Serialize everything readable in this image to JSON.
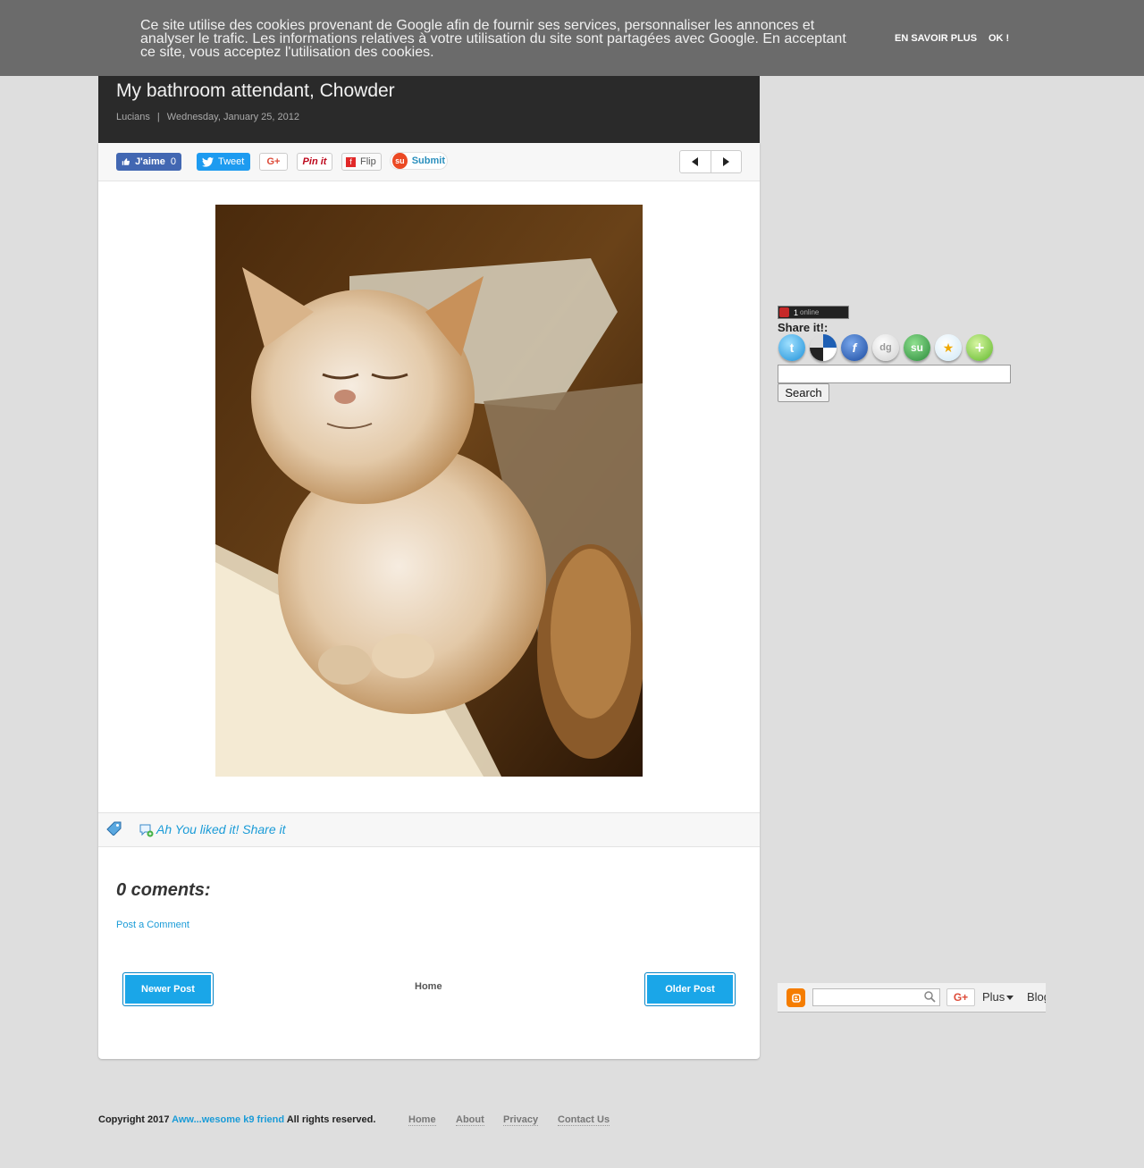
{
  "cookie_bar": {
    "text": "Ce site utilise des cookies provenant de Google afin de fournir ses services, personnaliser les annonces et analyser le trafic. Les informations relatives à votre utilisation du site sont partagées avec Google. En acceptant ce site, vous acceptez l'utilisation des cookies.",
    "learn_more": "EN SAVOIR PLUS",
    "ok": "OK !"
  },
  "post": {
    "title": "My bathroom attendant, Chowder",
    "author": "Lucians",
    "separator": "|",
    "date": "Wednesday, January 25, 2012"
  },
  "share_bar": {
    "fb_like": "J'aime",
    "fb_count": "0",
    "tweet": "Tweet",
    "gplus": "G+",
    "pinit": "Pin it",
    "flip": "Flip",
    "submit": "Submit"
  },
  "labels_bar": {
    "share_link": "Ah You liked it! Share it"
  },
  "comments": {
    "title": "0 coments:",
    "post_comment": "Post a Comment"
  },
  "pager": {
    "newer": "Newer Post",
    "home": "Home",
    "older": "Older Post"
  },
  "sidebar": {
    "online_count": "1",
    "online_label": "online",
    "share_it": "Share it!:",
    "share_icons": [
      "twitter-icon",
      "delicious-icon",
      "facebook-icon",
      "digg-icon",
      "stumbleupon-icon",
      "favorites-icon",
      "more-icon"
    ],
    "search_button": "Search"
  },
  "navbar": {
    "gplus": "G+",
    "more": "Plus",
    "blog": "Blog"
  },
  "footer": {
    "copyright_prefix": "Copyright 2017",
    "site_name": "Aww...wesome k9 friend",
    "rights": "All rights reserved.",
    "links": [
      "Home",
      "About",
      "Privacy",
      "Contact Us"
    ]
  },
  "colors": {
    "cookie_bar": "#6b6b6b",
    "header": "#2a2a2a",
    "accent": "#1a9bd7",
    "button": "#1aa6e8"
  }
}
